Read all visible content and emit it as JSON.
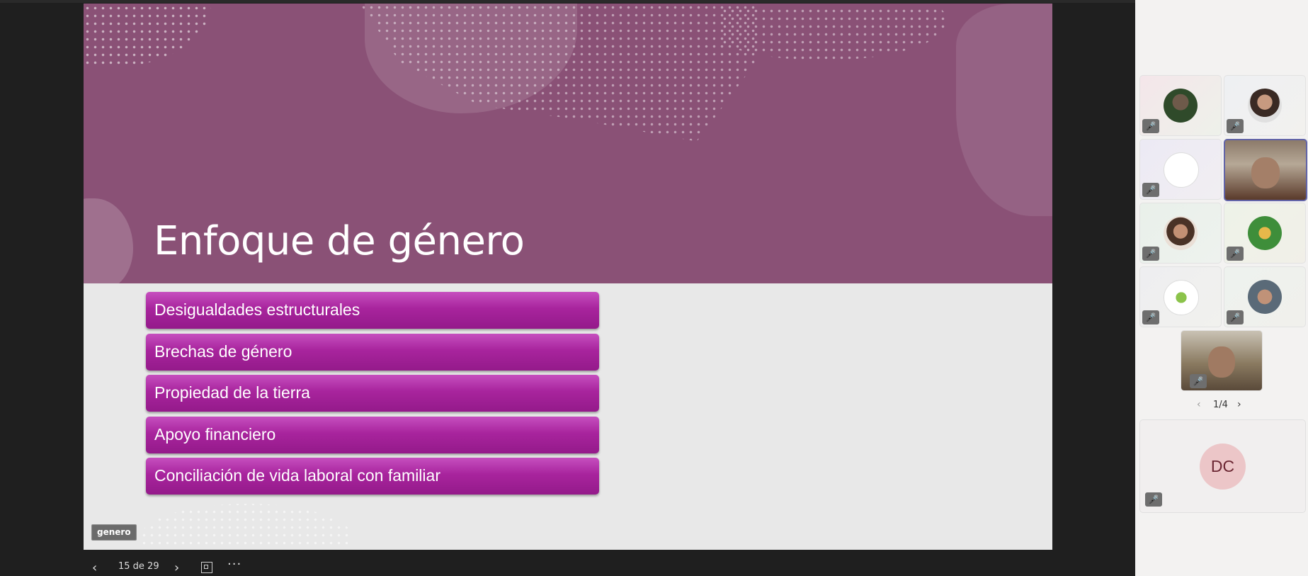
{
  "slide": {
    "title": "Enfoque de género",
    "bullets": [
      "Desigualdades estructurales",
      "Brechas de género",
      "Propiedad de la tierra",
      "Apoyo financiero",
      "Conciliación de vida laboral con familiar"
    ],
    "tag": "genero"
  },
  "navigation": {
    "prev_icon": "‹",
    "counter": "15 de 29",
    "next_icon": "›",
    "more_icon": "···"
  },
  "participants": {
    "pager": {
      "prev": "‹",
      "text": "1/4",
      "next": "›"
    },
    "mic_icon": "🎤",
    "self_initials": "DC"
  },
  "colors": {
    "banner": "#8a5176",
    "bullet": "#a8249d",
    "active_border": "#6264a7"
  }
}
